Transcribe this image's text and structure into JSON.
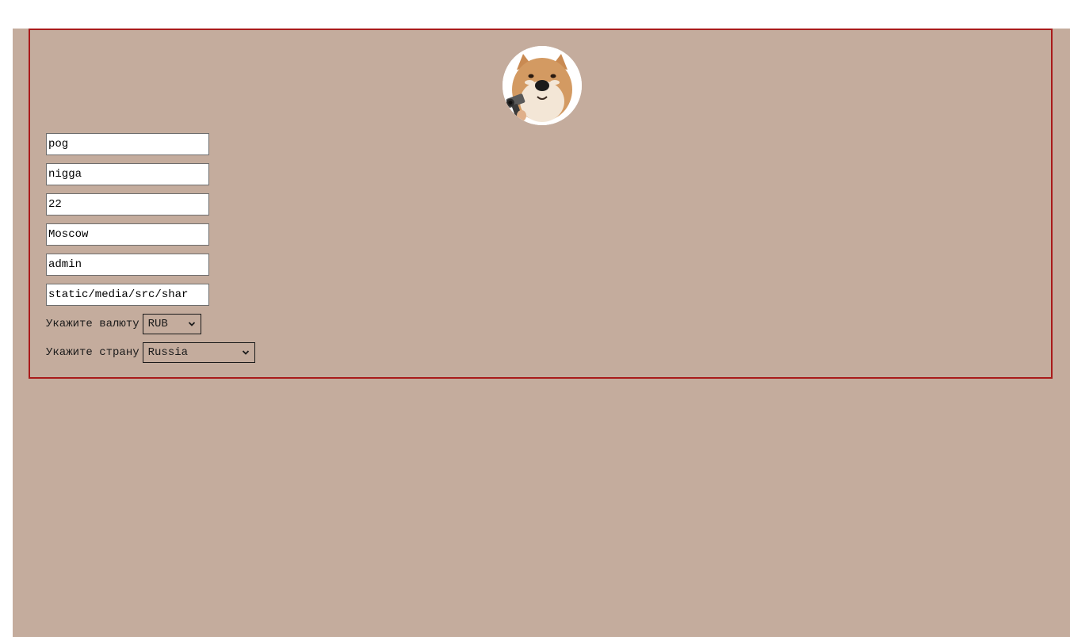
{
  "profile": {
    "avatar_icon": "shiba-dog-with-pistol-avatar",
    "fields": [
      {
        "name": "first-name-field",
        "value": "pog"
      },
      {
        "name": "last-name-field",
        "value": "nigga"
      },
      {
        "name": "age-field",
        "value": "22"
      },
      {
        "name": "city-field",
        "value": "Moscow"
      },
      {
        "name": "role-field",
        "value": "admin"
      },
      {
        "name": "avatar-path-field",
        "value": "static/media/src/shar"
      }
    ],
    "currency": {
      "label": "Укажите валюту",
      "selected": "RUB"
    },
    "country": {
      "label": "Укажите страну",
      "selected": "Russia"
    }
  },
  "colors": {
    "background": "#c4ac9d",
    "card_border": "#a91a1a"
  }
}
